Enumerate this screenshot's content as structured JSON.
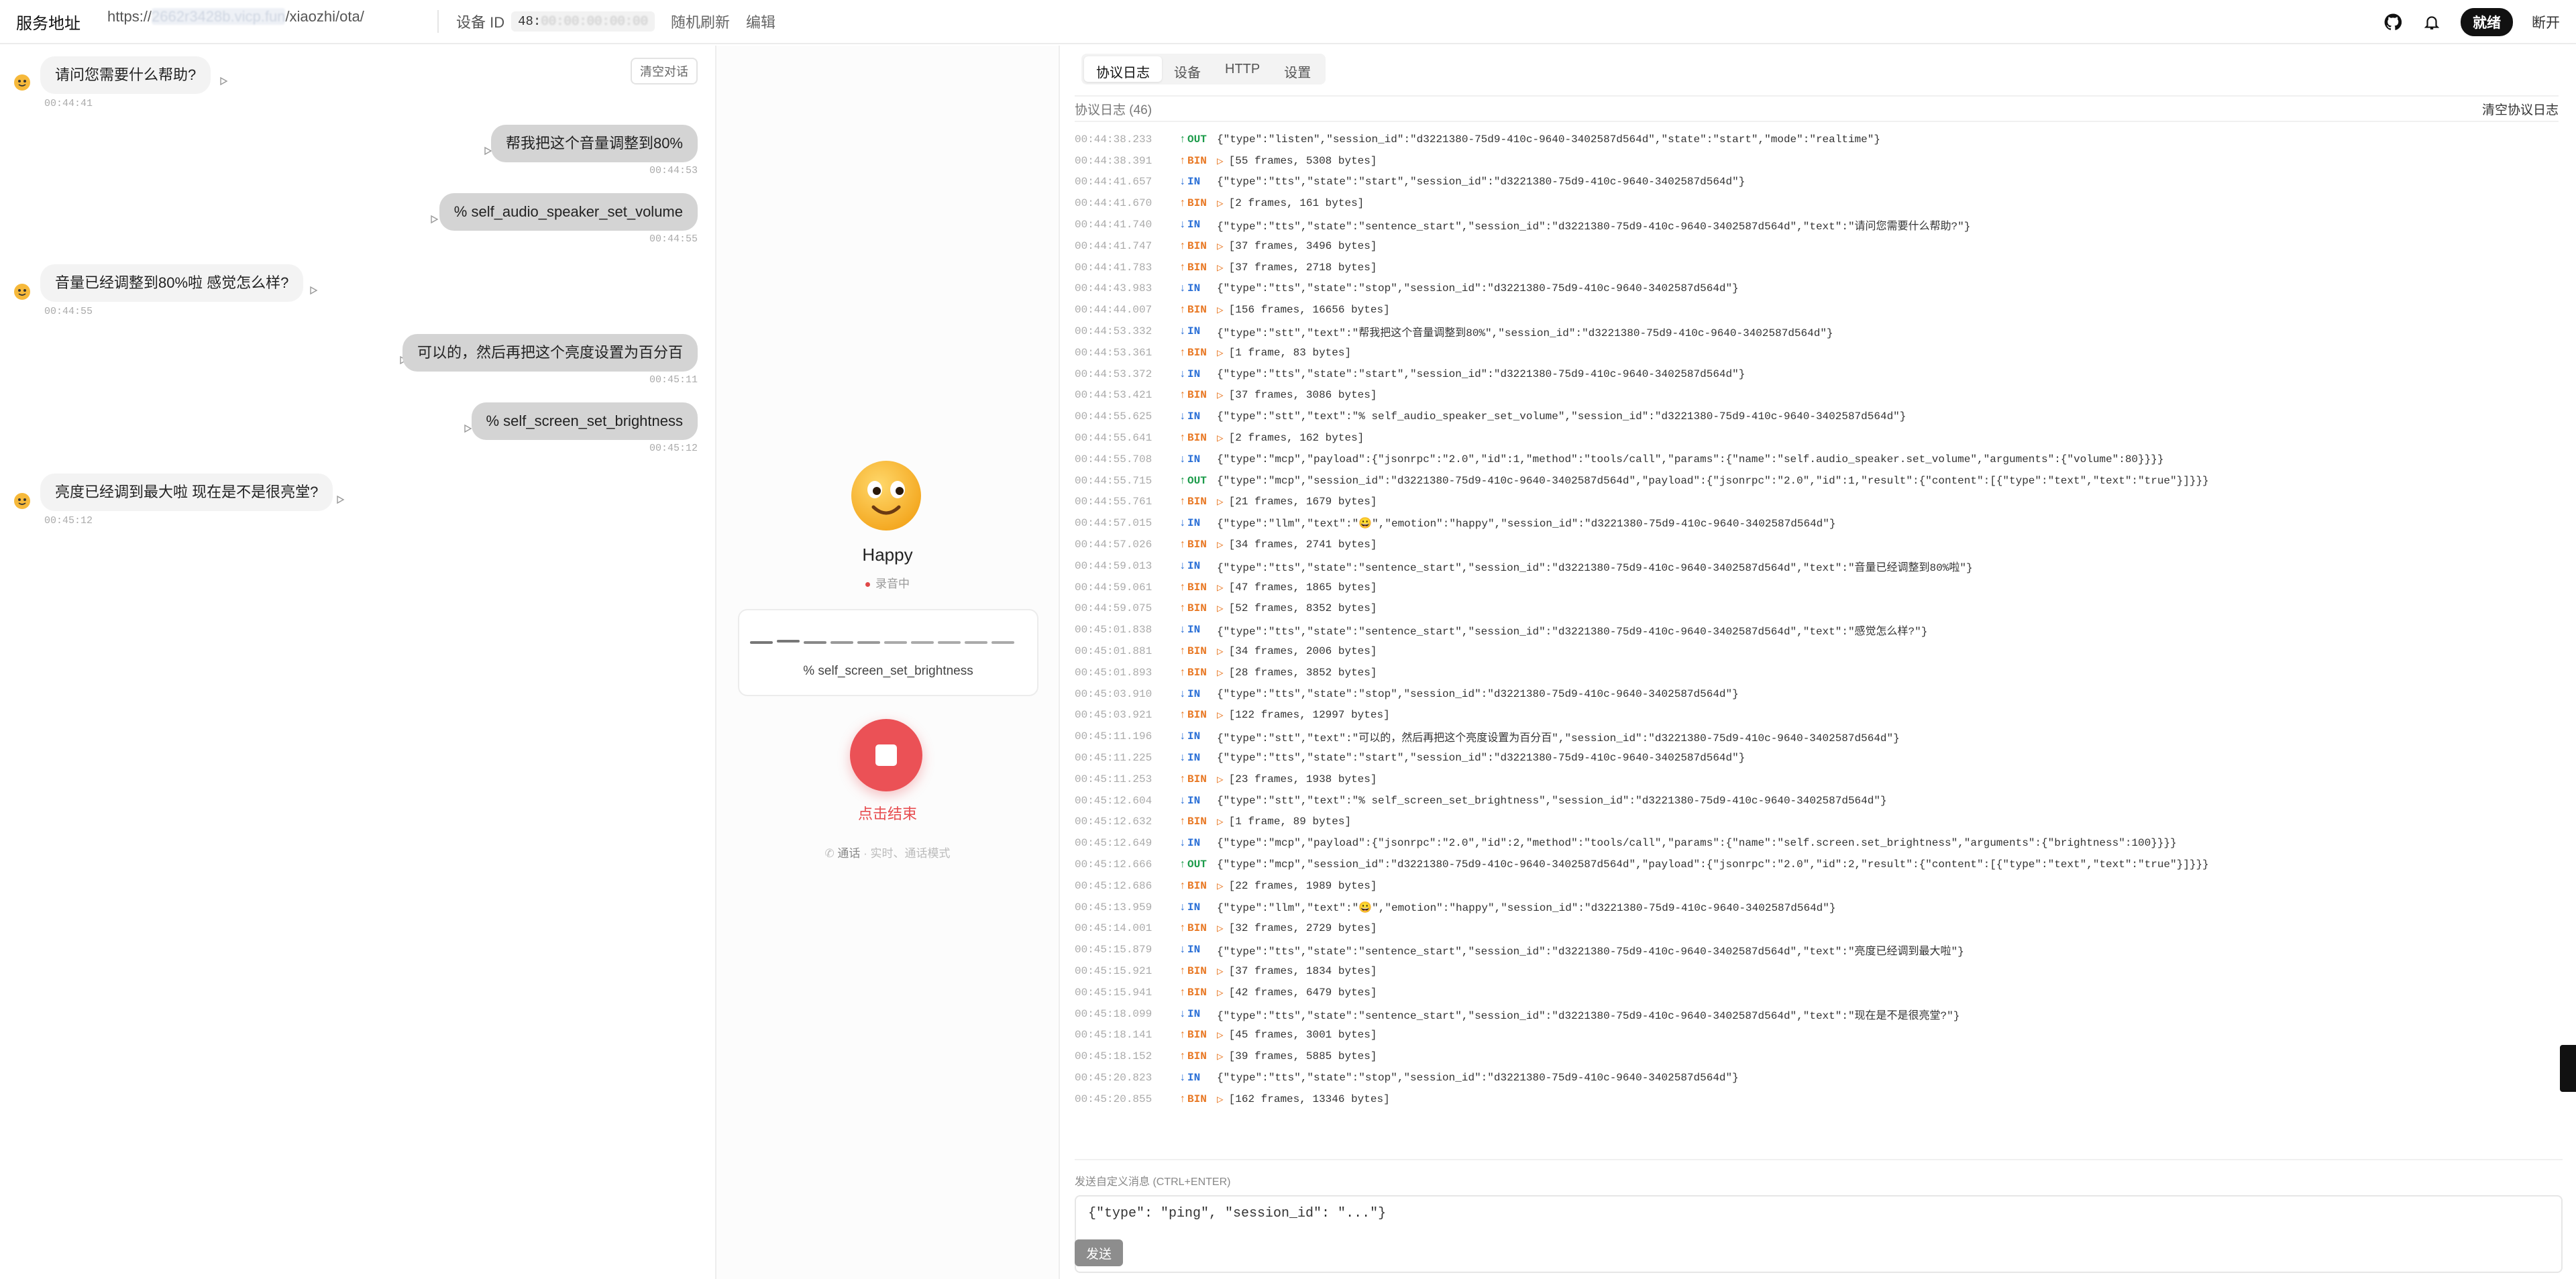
{
  "header": {
    "title": "服务地址",
    "url_prefix": "https://",
    "url_blurred": "2662r3428b.vicp.fun",
    "url_suffix": "/xiaozhi/ota/",
    "device_label": "设备 ID",
    "device_id_prefix": "48:",
    "device_id_blurred": "00:00:00:00:00",
    "random_refresh": "随机刷新",
    "edit": "编辑",
    "status_badge": "就绪",
    "disconnect": "断开"
  },
  "chat": {
    "clear_label": "清空对话",
    "messages": [
      {
        "role": "bot",
        "text": "请问您需要什么帮助?",
        "time": "00:44:41"
      },
      {
        "role": "user",
        "text": "帮我把这个音量调整到80%",
        "time": "00:44:53"
      },
      {
        "role": "user",
        "text": "% self_audio_speaker_set_volume",
        "time": "00:44:55"
      },
      {
        "role": "bot",
        "text": "音量已经调整到80%啦 感觉怎么样?",
        "time": "00:44:55"
      },
      {
        "role": "user",
        "text": "可以的，然后再把这个亮度设置为百分百",
        "time": "00:45:11"
      },
      {
        "role": "user",
        "text": "% self_screen_set_brightness",
        "time": "00:45:12"
      },
      {
        "role": "bot",
        "text": "亮度已经调到最大啦 现在是不是很亮堂?",
        "time": "00:45:12"
      }
    ]
  },
  "center": {
    "emotion": "Happy",
    "recording": "录音中",
    "wave_text": "% self_screen_set_brightness",
    "stop_label": "点击结束",
    "call_mode": "通话",
    "call_mode_desc": "· 实时、通话模式"
  },
  "logs": {
    "tabs": [
      "协议日志",
      "设备",
      "HTTP",
      "设置"
    ],
    "count_label": "协议日志 (46)",
    "clear_label": "清空协议日志",
    "entries": [
      {
        "t": "00:44:38.233",
        "d": "OUT",
        "m": "{\"type\":\"listen\",\"session_id\":\"d3221380-75d9-410c-9640-3402587d564d\",\"state\":\"start\",\"mode\":\"realtime\"}"
      },
      {
        "t": "00:44:38.391",
        "d": "BIN",
        "m": "[55 frames, 5308 bytes]"
      },
      {
        "t": "00:44:41.657",
        "d": "IN",
        "m": "{\"type\":\"tts\",\"state\":\"start\",\"session_id\":\"d3221380-75d9-410c-9640-3402587d564d\"}"
      },
      {
        "t": "00:44:41.670",
        "d": "BIN",
        "m": "[2 frames, 161 bytes]"
      },
      {
        "t": "00:44:41.740",
        "d": "IN",
        "m": "{\"type\":\"tts\",\"state\":\"sentence_start\",\"session_id\":\"d3221380-75d9-410c-9640-3402587d564d\",\"text\":\"请问您需要什么帮助?\"}"
      },
      {
        "t": "00:44:41.747",
        "d": "BIN",
        "m": "[37 frames, 3496 bytes]"
      },
      {
        "t": "00:44:41.783",
        "d": "BIN",
        "m": "[37 frames, 2718 bytes]"
      },
      {
        "t": "00:44:43.983",
        "d": "IN",
        "m": "{\"type\":\"tts\",\"state\":\"stop\",\"session_id\":\"d3221380-75d9-410c-9640-3402587d564d\"}"
      },
      {
        "t": "00:44:44.007",
        "d": "BIN",
        "m": "[156 frames, 16656 bytes]"
      },
      {
        "t": "00:44:53.332",
        "d": "IN",
        "m": "{\"type\":\"stt\",\"text\":\"帮我把这个音量调整到80%\",\"session_id\":\"d3221380-75d9-410c-9640-3402587d564d\"}"
      },
      {
        "t": "00:44:53.361",
        "d": "BIN",
        "m": "[1 frame, 83 bytes]"
      },
      {
        "t": "00:44:53.372",
        "d": "IN",
        "m": "{\"type\":\"tts\",\"state\":\"start\",\"session_id\":\"d3221380-75d9-410c-9640-3402587d564d\"}"
      },
      {
        "t": "00:44:53.421",
        "d": "BIN",
        "m": "[37 frames, 3086 bytes]"
      },
      {
        "t": "00:44:55.625",
        "d": "IN",
        "m": "{\"type\":\"stt\",\"text\":\"% self_audio_speaker_set_volume\",\"session_id\":\"d3221380-75d9-410c-9640-3402587d564d\"}"
      },
      {
        "t": "00:44:55.641",
        "d": "BIN",
        "m": "[2 frames, 162 bytes]"
      },
      {
        "t": "00:44:55.708",
        "d": "IN",
        "m": "{\"type\":\"mcp\",\"payload\":{\"jsonrpc\":\"2.0\",\"id\":1,\"method\":\"tools/call\",\"params\":{\"name\":\"self.audio_speaker.set_volume\",\"arguments\":{\"volume\":80}}}}"
      },
      {
        "t": "00:44:55.715",
        "d": "OUT",
        "m": "{\"type\":\"mcp\",\"session_id\":\"d3221380-75d9-410c-9640-3402587d564d\",\"payload\":{\"jsonrpc\":\"2.0\",\"id\":1,\"result\":{\"content\":[{\"type\":\"text\",\"text\":\"true\"}]}}}"
      },
      {
        "t": "00:44:55.761",
        "d": "BIN",
        "m": "[21 frames, 1679 bytes]"
      },
      {
        "t": "00:44:57.015",
        "d": "IN",
        "m": "{\"type\":\"llm\",\"text\":\"😀\",\"emotion\":\"happy\",\"session_id\":\"d3221380-75d9-410c-9640-3402587d564d\"}"
      },
      {
        "t": "00:44:57.026",
        "d": "BIN",
        "m": "[34 frames, 2741 bytes]"
      },
      {
        "t": "00:44:59.013",
        "d": "IN",
        "m": "{\"type\":\"tts\",\"state\":\"sentence_start\",\"session_id\":\"d3221380-75d9-410c-9640-3402587d564d\",\"text\":\"音量已经调整到80%啦\"}"
      },
      {
        "t": "00:44:59.061",
        "d": "BIN",
        "m": "[47 frames, 1865 bytes]"
      },
      {
        "t": "00:44:59.075",
        "d": "BIN",
        "m": "[52 frames, 8352 bytes]"
      },
      {
        "t": "00:45:01.838",
        "d": "IN",
        "m": "{\"type\":\"tts\",\"state\":\"sentence_start\",\"session_id\":\"d3221380-75d9-410c-9640-3402587d564d\",\"text\":\"感觉怎么样?\"}"
      },
      {
        "t": "00:45:01.881",
        "d": "BIN",
        "m": "[34 frames, 2006 bytes]"
      },
      {
        "t": "00:45:01.893",
        "d": "BIN",
        "m": "[28 frames, 3852 bytes]"
      },
      {
        "t": "00:45:03.910",
        "d": "IN",
        "m": "{\"type\":\"tts\",\"state\":\"stop\",\"session_id\":\"d3221380-75d9-410c-9640-3402587d564d\"}"
      },
      {
        "t": "00:45:03.921",
        "d": "BIN",
        "m": "[122 frames, 12997 bytes]"
      },
      {
        "t": "00:45:11.196",
        "d": "IN",
        "m": "{\"type\":\"stt\",\"text\":\"可以的，然后再把这个亮度设置为百分百\",\"session_id\":\"d3221380-75d9-410c-9640-3402587d564d\"}"
      },
      {
        "t": "00:45:11.225",
        "d": "IN",
        "m": "{\"type\":\"tts\",\"state\":\"start\",\"session_id\":\"d3221380-75d9-410c-9640-3402587d564d\"}"
      },
      {
        "t": "00:45:11.253",
        "d": "BIN",
        "m": "[23 frames, 1938 bytes]"
      },
      {
        "t": "00:45:12.604",
        "d": "IN",
        "m": "{\"type\":\"stt\",\"text\":\"% self_screen_set_brightness\",\"session_id\":\"d3221380-75d9-410c-9640-3402587d564d\"}"
      },
      {
        "t": "00:45:12.632",
        "d": "BIN",
        "m": "[1 frame, 89 bytes]"
      },
      {
        "t": "00:45:12.649",
        "d": "IN",
        "m": "{\"type\":\"mcp\",\"payload\":{\"jsonrpc\":\"2.0\",\"id\":2,\"method\":\"tools/call\",\"params\":{\"name\":\"self.screen.set_brightness\",\"arguments\":{\"brightness\":100}}}}"
      },
      {
        "t": "00:45:12.666",
        "d": "OUT",
        "m": "{\"type\":\"mcp\",\"session_id\":\"d3221380-75d9-410c-9640-3402587d564d\",\"payload\":{\"jsonrpc\":\"2.0\",\"id\":2,\"result\":{\"content\":[{\"type\":\"text\",\"text\":\"true\"}]}}}"
      },
      {
        "t": "00:45:12.686",
        "d": "BIN",
        "m": "[22 frames, 1989 bytes]"
      },
      {
        "t": "00:45:13.959",
        "d": "IN",
        "m": "{\"type\":\"llm\",\"text\":\"😀\",\"emotion\":\"happy\",\"session_id\":\"d3221380-75d9-410c-9640-3402587d564d\"}"
      },
      {
        "t": "00:45:14.001",
        "d": "BIN",
        "m": "[32 frames, 2729 bytes]"
      },
      {
        "t": "00:45:15.879",
        "d": "IN",
        "m": "{\"type\":\"tts\",\"state\":\"sentence_start\",\"session_id\":\"d3221380-75d9-410c-9640-3402587d564d\",\"text\":\"亮度已经调到最大啦\"}"
      },
      {
        "t": "00:45:15.921",
        "d": "BIN",
        "m": "[37 frames, 1834 bytes]"
      },
      {
        "t": "00:45:15.941",
        "d": "BIN",
        "m": "[42 frames, 6479 bytes]"
      },
      {
        "t": "00:45:18.099",
        "d": "IN",
        "m": "{\"type\":\"tts\",\"state\":\"sentence_start\",\"session_id\":\"d3221380-75d9-410c-9640-3402587d564d\",\"text\":\"现在是不是很亮堂?\"}"
      },
      {
        "t": "00:45:18.141",
        "d": "BIN",
        "m": "[45 frames, 3001 bytes]"
      },
      {
        "t": "00:45:18.152",
        "d": "BIN",
        "m": "[39 frames, 5885 bytes]"
      },
      {
        "t": "00:45:20.823",
        "d": "IN",
        "m": "{\"type\":\"tts\",\"state\":\"stop\",\"session_id\":\"d3221380-75d9-410c-9640-3402587d564d\"}"
      },
      {
        "t": "00:45:20.855",
        "d": "BIN",
        "m": "[162 frames, 13346 bytes]"
      }
    ],
    "send_label": "发送自定义消息 (CTRL+ENTER)",
    "send_value": "{\"type\": \"ping\", \"session_id\": \"...\"}",
    "send_button": "发送"
  },
  "colors": {
    "out": "#1c9b4a",
    "in": "#2a6fd6",
    "bin": "#e87722",
    "stop": "#eb5156"
  }
}
